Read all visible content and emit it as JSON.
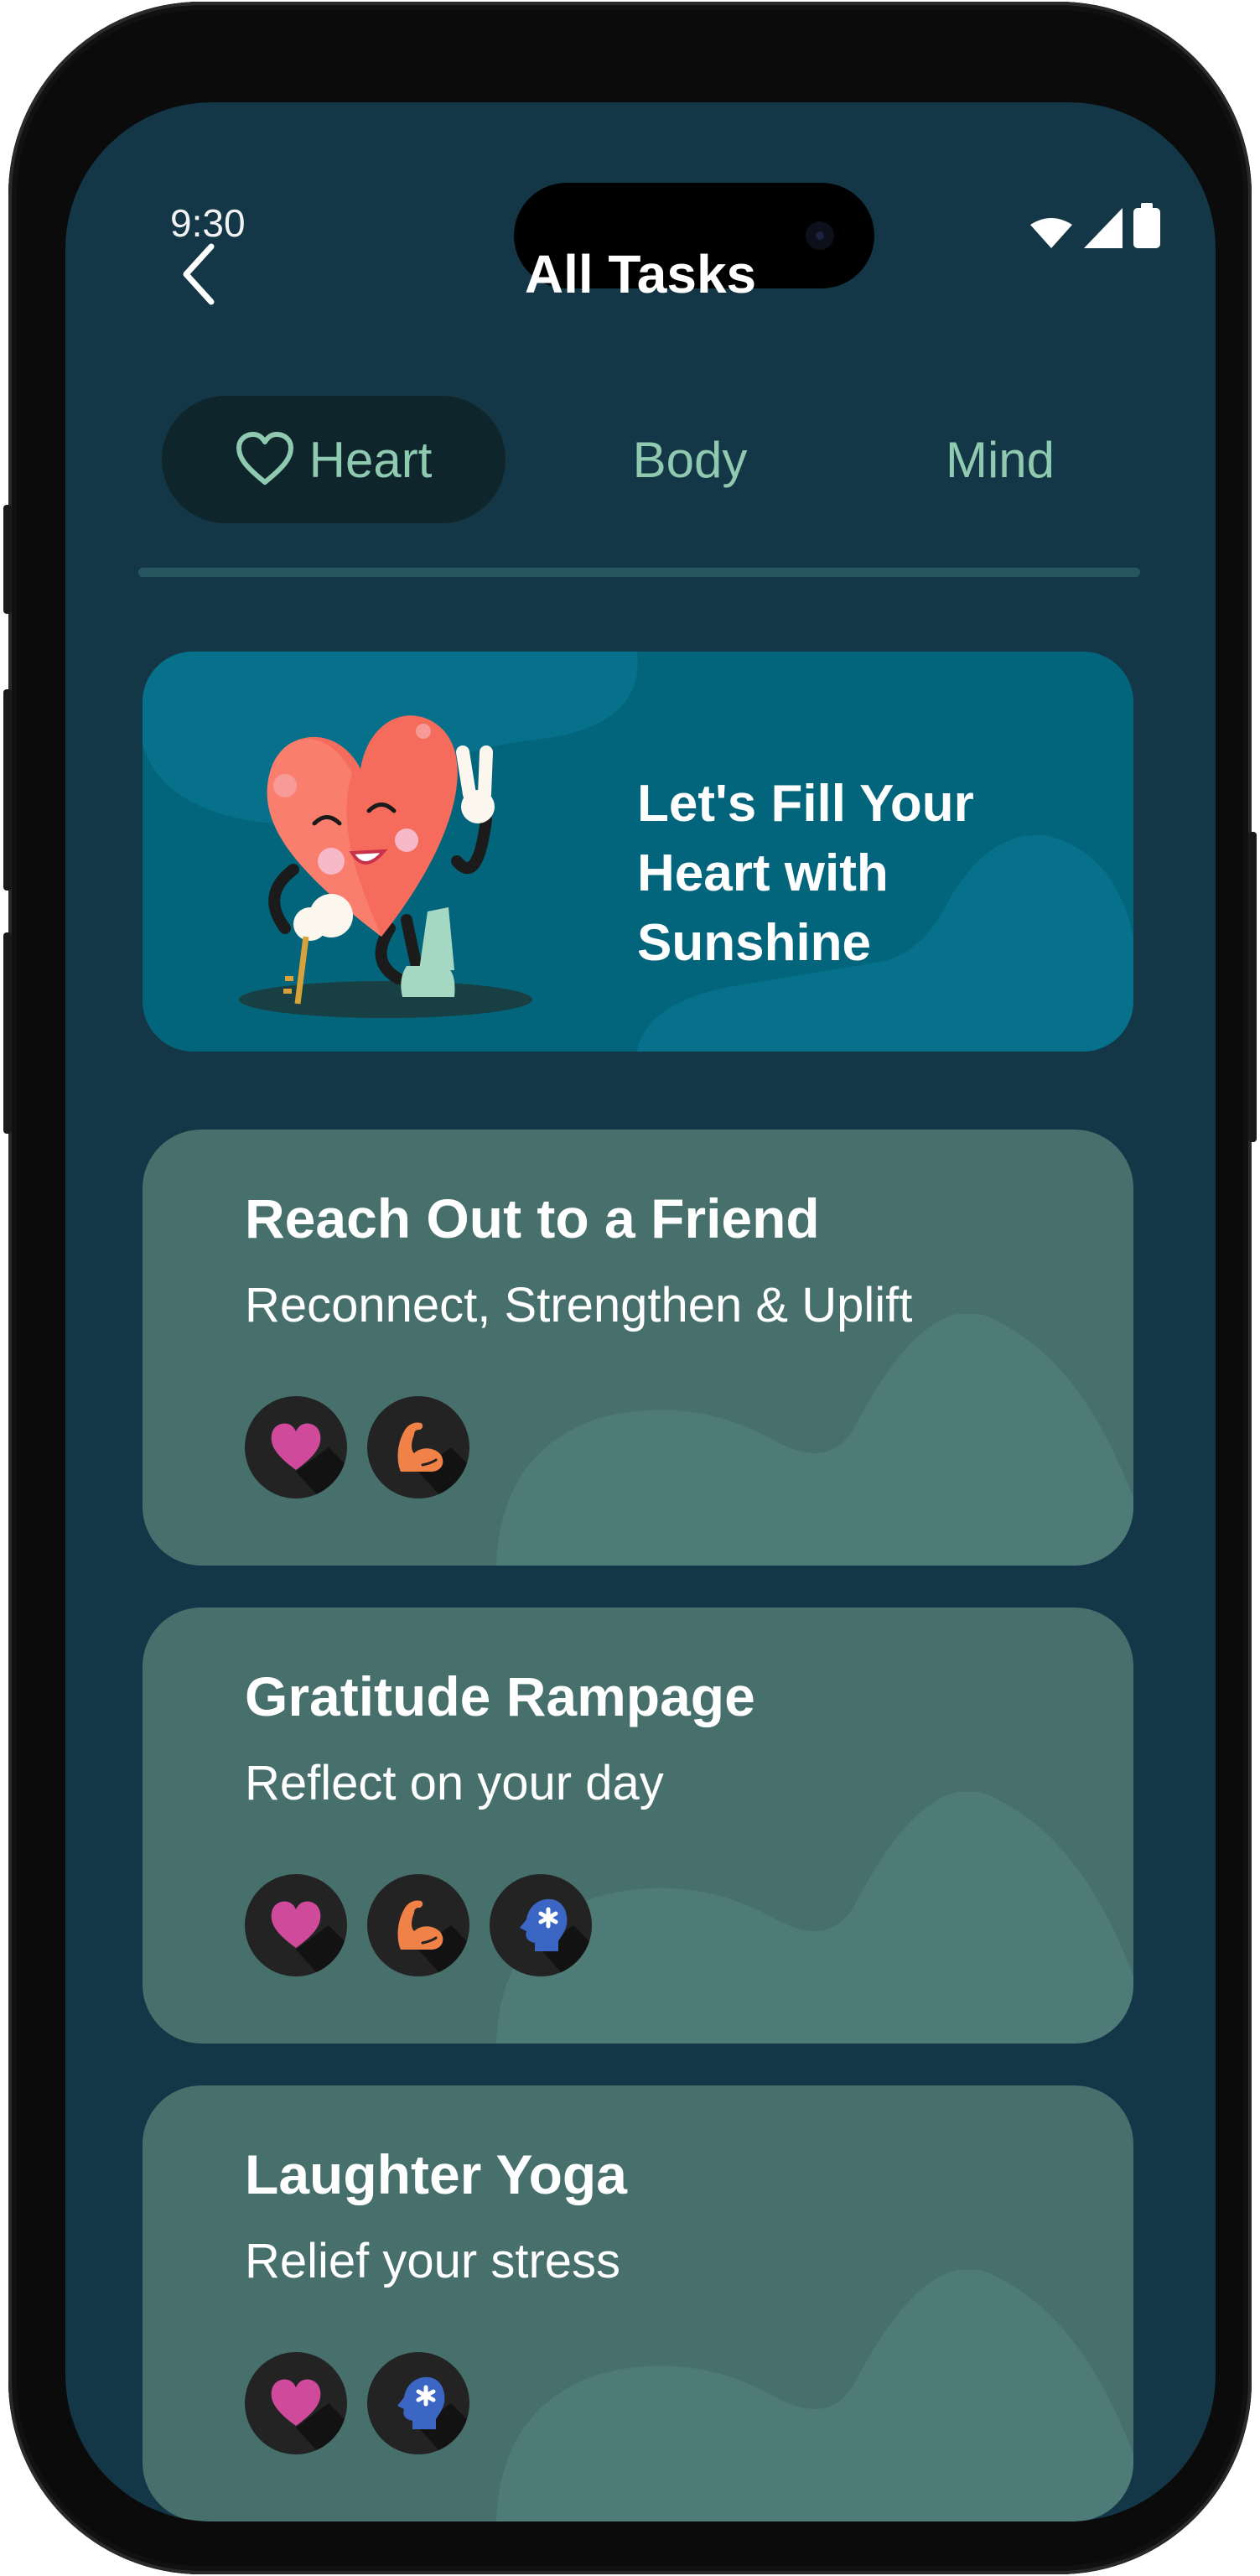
{
  "status_bar": {
    "time": "9:30",
    "icons": [
      "wifi-icon",
      "cellular-signal-icon",
      "battery-icon"
    ]
  },
  "header": {
    "back_icon": "chevron-left-icon",
    "title": "All Tasks"
  },
  "tabs": [
    {
      "label": "Heart",
      "icon": "heart-outline-icon",
      "active": true
    },
    {
      "label": "Body",
      "active": false
    },
    {
      "label": "Mind",
      "active": false
    }
  ],
  "banner": {
    "illustration": "heart-mascot-illustration",
    "text": "Let's Fill Your Heart with Sunshine"
  },
  "tasks": [
    {
      "title": "Reach Out to a Friend",
      "subtitle": "Reconnect, Strengthen & Uplift",
      "badges": [
        "heart",
        "body"
      ]
    },
    {
      "title": "Gratitude Rampage",
      "subtitle": "Reflect on your day",
      "badges": [
        "heart",
        "body",
        "mind"
      ]
    },
    {
      "title": "Laughter Yoga",
      "subtitle": "Relief your stress",
      "badges": [
        "heart",
        "mind"
      ]
    }
  ],
  "colors": {
    "background": "#133746",
    "accent_tab": "#8ec9b0",
    "banner": "#03657b",
    "card": "#47706d",
    "badge_heart": "#cf4a9b",
    "badge_body": "#f08147",
    "badge_mind": "#3c66c4"
  }
}
